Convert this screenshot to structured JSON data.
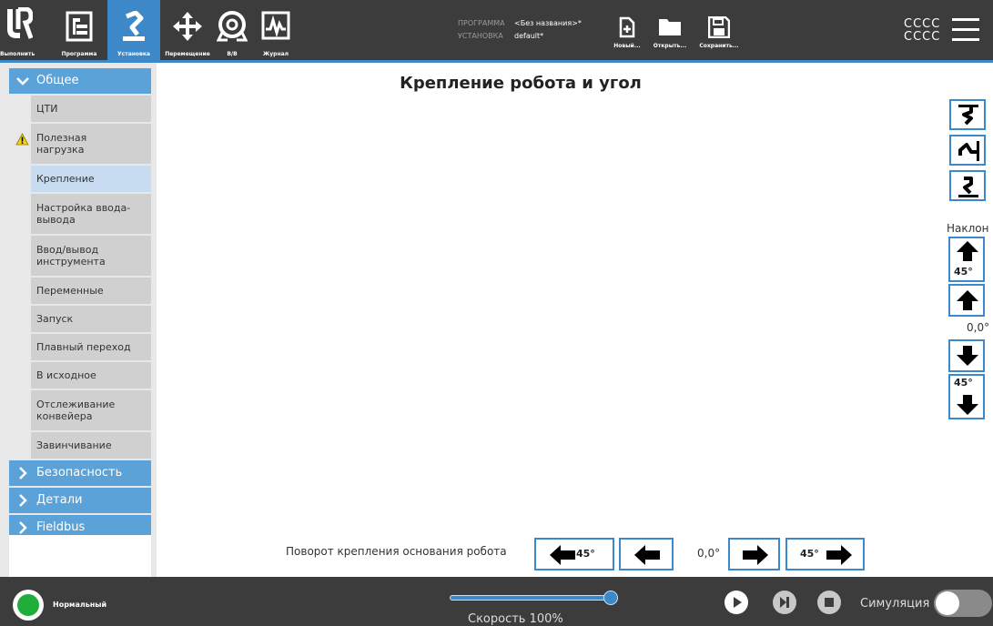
{
  "header": {
    "nav": [
      {
        "id": "run",
        "label": "Выполнить",
        "icon": "run-icon"
      },
      {
        "id": "program",
        "label": "Программа",
        "icon": "program-icon"
      },
      {
        "id": "installation",
        "label": "Установка",
        "icon": "installation-icon",
        "active": true
      },
      {
        "id": "move",
        "label": "Перемещение",
        "icon": "move-icon"
      },
      {
        "id": "io",
        "label": "В/В",
        "icon": "io-icon"
      },
      {
        "id": "log",
        "label": "Журнал",
        "icon": "log-icon"
      }
    ],
    "program_key": "ПРОГРАММА",
    "program_value": "<Без названия>*",
    "installation_key": "УСТАНОВКА",
    "installation_value": "default*",
    "file_new_label": "Новый...",
    "file_open_label": "Открыть...",
    "file_save_label": "Сохранить...",
    "status_line1": "CCCC",
    "status_line2": "CCCC",
    "accent_color": "#3c88c8"
  },
  "sidebar": {
    "general_label": "Общее",
    "items": [
      {
        "label": "ЦТИ"
      },
      {
        "label": "Полезная нагрузка",
        "warning": true
      },
      {
        "label": "Крепление",
        "active": true
      },
      {
        "label": "Настройка ввода-вывода"
      },
      {
        "label": "Ввод/вывод инструмента"
      },
      {
        "label": "Переменные"
      },
      {
        "label": "Запуск"
      },
      {
        "label": "Плавный переход"
      },
      {
        "label": "В исходное"
      },
      {
        "label": "Отслеживание конвейера"
      },
      {
        "label": "Завинчивание"
      }
    ],
    "safety_label": "Безопасность",
    "details_label": "Детали",
    "fieldbus_label": "Fieldbus"
  },
  "main": {
    "title": "Крепление робота и угол",
    "tilt_label": "Наклон",
    "tilt_step_up": "45°",
    "tilt_value": "0,0°",
    "tilt_step_down": "45°",
    "rotation_label": "Поворот крепления основания робота",
    "rotation_left_step": "45°",
    "rotation_value": "0,0°",
    "rotation_right_step": "45°"
  },
  "footer": {
    "status_text": "Нормальный",
    "status_color": "#1fae3a",
    "speed_text": "Скорость 100%",
    "speed_fraction": 1.0,
    "simulation_label": "Симуляция",
    "simulation_on": false
  }
}
